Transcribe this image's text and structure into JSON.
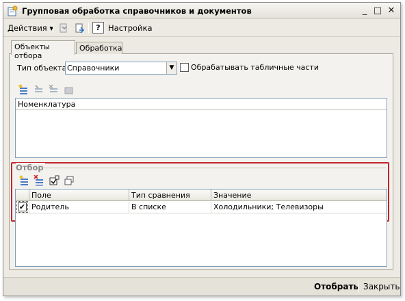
{
  "window": {
    "title": "Групповая обработка справочников и документов",
    "controls": {
      "minimize": "_",
      "maximize": "□",
      "close": "✕"
    }
  },
  "toolbar": {
    "actions_label": "Действия ▾",
    "help_label": "?",
    "settings_label": "Настройка",
    "icons": [
      "save-settings-icon",
      "restore-settings-icon"
    ]
  },
  "tabs": [
    {
      "label": "Объекты отбора",
      "active": true
    },
    {
      "label": "Обработка",
      "active": false
    }
  ],
  "object_type": {
    "label": "Тип объекта:",
    "value": "Справочники",
    "dropdown_arrow": "▼"
  },
  "process_table_parts": {
    "label": "Обрабатывать табличные части",
    "checked": false
  },
  "objects_toolbar_icons": [
    "add-icon",
    "copy-icon",
    "delete-icon",
    "edit-icon"
  ],
  "objects_list": {
    "items": [
      "Номенклатура"
    ]
  },
  "filter": {
    "title": "Отбор",
    "toolbar_icons": [
      "add-condition-icon",
      "delete-condition-icon",
      "select-all-icon",
      "copy-icon"
    ],
    "columns": [
      "Поле",
      "Тип сравнения",
      "Значение"
    ],
    "rows": [
      {
        "checked": true,
        "check_mark": "✔",
        "field": "Родитель",
        "comparison": "В списке",
        "value": "Холодильники; Телевизоры"
      }
    ]
  },
  "footer": {
    "select_button": "Отобрать",
    "close_button": "Закрыть"
  },
  "colors": {
    "highlight_frame": "#c4242c",
    "window_bg": "#eceae2",
    "panel_bg": "#f3f2ee"
  }
}
